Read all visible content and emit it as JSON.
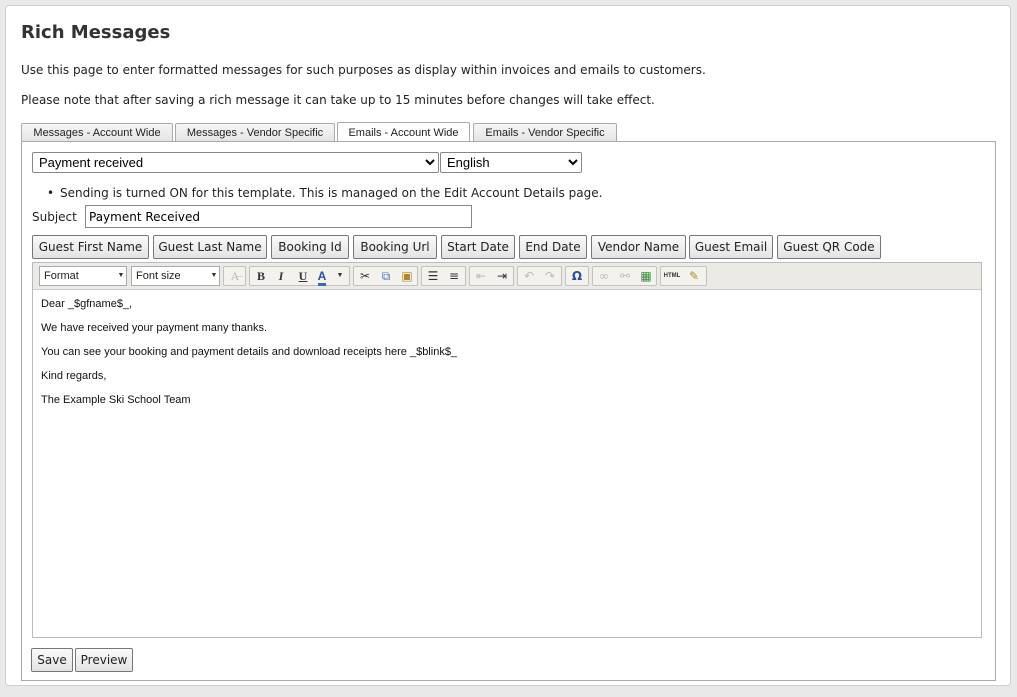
{
  "page": {
    "title": "Rich Messages",
    "intro": "Use this page to enter formatted messages for such purposes as display within invoices and emails to customers.",
    "note": "Please note that after saving a rich message it can take up to 15 minutes before changes will take effect."
  },
  "tabs": [
    {
      "label": "Messages - Account Wide"
    },
    {
      "label": "Messages - Vendor Specific"
    },
    {
      "label": "Emails - Account Wide"
    },
    {
      "label": "Emails - Vendor Specific"
    }
  ],
  "template_select": {
    "value": "Payment received"
  },
  "language_select": {
    "value": "English"
  },
  "status_note": "Sending is turned ON for this template. This is managed on the Edit Account Details page.",
  "subject": {
    "label": "Subject",
    "value": "Payment Received"
  },
  "placeholders": [
    "Guest First Name",
    "Guest Last Name",
    "Booking Id",
    "Booking Url",
    "Start Date",
    "End Date",
    "Vendor Name",
    "Guest Email",
    "Guest QR Code"
  ],
  "toolbar": {
    "format_label": "Format",
    "font_size_label": "Font size"
  },
  "editor": {
    "lines": [
      "Dear  _$gfname$_,",
      "We have received your payment many thanks.",
      "You can see your booking and payment details and download receipts here _$blink$_",
      "Kind regards,",
      "The Example Ski School Team"
    ]
  },
  "actions": {
    "save": "Save",
    "preview": "Preview"
  },
  "colors": {
    "text_color_bar": "#2a6bd1",
    "toolbar_bg": "#eceae6"
  }
}
